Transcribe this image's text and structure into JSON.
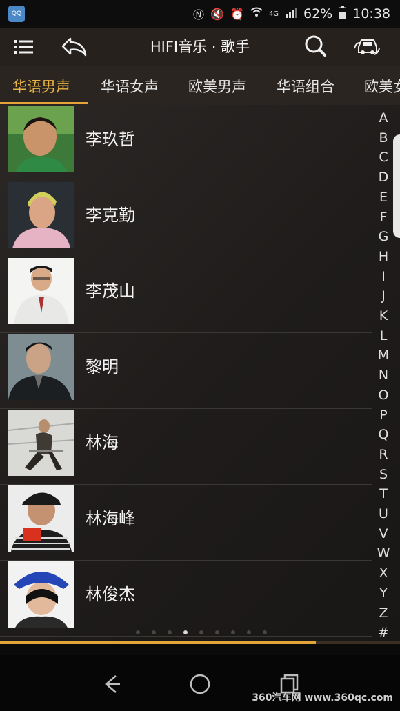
{
  "status": {
    "app_icon_label": "QQ",
    "network": "4G",
    "battery": "62%",
    "time": "10:38"
  },
  "header": {
    "title": "HIFI音乐 · 歌手"
  },
  "tabs": [
    {
      "label": "华语男声",
      "active": true
    },
    {
      "label": "华语女声",
      "active": false
    },
    {
      "label": "欧美男声",
      "active": false
    },
    {
      "label": "华语组合",
      "active": false
    },
    {
      "label": "欧美女声",
      "active": false
    }
  ],
  "singers": [
    {
      "name": "李玖哲"
    },
    {
      "name": "李克勤"
    },
    {
      "name": "李茂山"
    },
    {
      "name": "黎明"
    },
    {
      "name": "林海"
    },
    {
      "name": "林海峰"
    },
    {
      "name": "林俊杰"
    }
  ],
  "alpha_index": [
    "A",
    "B",
    "C",
    "D",
    "E",
    "F",
    "G",
    "H",
    "I",
    "J",
    "K",
    "L",
    "M",
    "N",
    "O",
    "P",
    "Q",
    "R",
    "S",
    "T",
    "U",
    "V",
    "W",
    "X",
    "Y",
    "Z",
    "#"
  ],
  "pager": {
    "count": 9,
    "active": 3
  },
  "progress": 0.79,
  "watermark": "360汽车网 www.360qc.com",
  "colors": {
    "accent": "#e2a53a",
    "header": "#26211d"
  }
}
